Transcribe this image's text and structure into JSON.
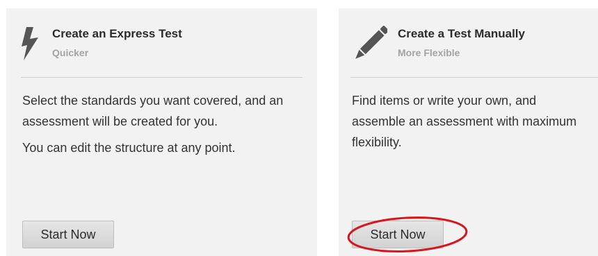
{
  "cards": [
    {
      "title": "Create an Express Test",
      "subtitle": "Quicker",
      "icon": "lightning-bolt-icon",
      "body": [
        "Select the standards you want covered, and an assessment will be created for you.",
        "You can edit the structure at any point."
      ],
      "button_label": "Start Now"
    },
    {
      "title": "Create a Test Manually",
      "subtitle": "More Flexible",
      "icon": "pencil-icon",
      "body": [
        "Find items or write your own, and assemble an assessment with maximum flexibility."
      ],
      "button_label": "Start Now"
    }
  ],
  "colors": {
    "card_background": "#f2f2f2",
    "title_text": "#2b2b2b",
    "subtitle_text": "#a3a3a3",
    "body_text": "#333333",
    "icon": "#555555",
    "highlight_annotation": "#d9141b"
  }
}
